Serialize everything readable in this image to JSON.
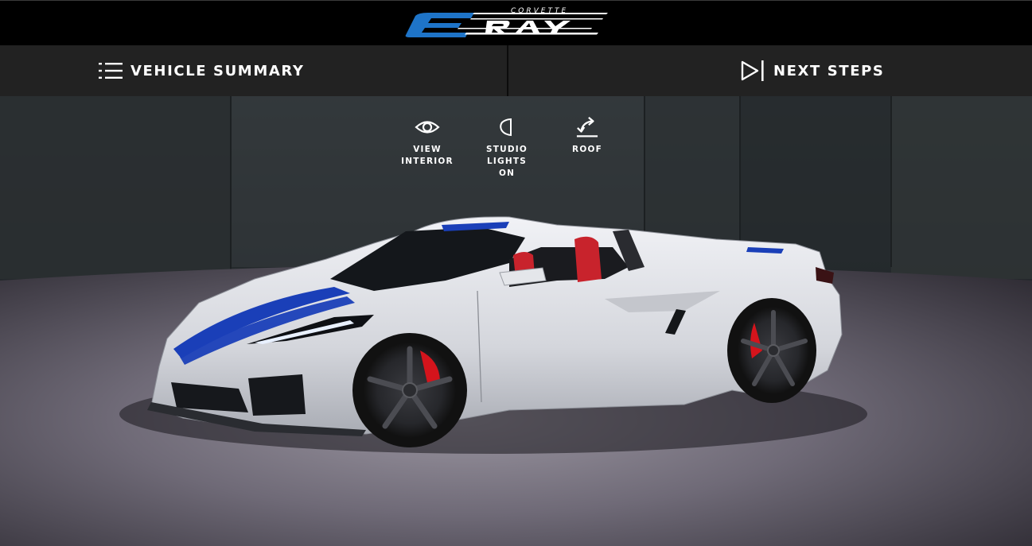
{
  "brand": {
    "logo_text_small": "CORVETTE",
    "logo_text_large": "E-RAY",
    "accent_color": "#1e74c8"
  },
  "nav": {
    "summary": {
      "label": "VEHICLE SUMMARY",
      "icon": "list-icon"
    },
    "next": {
      "label": "NEXT STEPS",
      "icon": "play-next-icon"
    }
  },
  "tools": [
    {
      "label": "VIEW\nINTERIOR",
      "icon": "eye-icon"
    },
    {
      "label": "STUDIO LIGHTS\nON",
      "icon": "light-icon"
    },
    {
      "label": "ROOF",
      "icon": "roof-arrow-icon"
    }
  ],
  "vehicle": {
    "body_color": "#d9dbe0",
    "stripe_color": "#1a3fb8",
    "caliper_color": "#d4141c",
    "interior_color": "#c8232c",
    "convertible": true
  }
}
